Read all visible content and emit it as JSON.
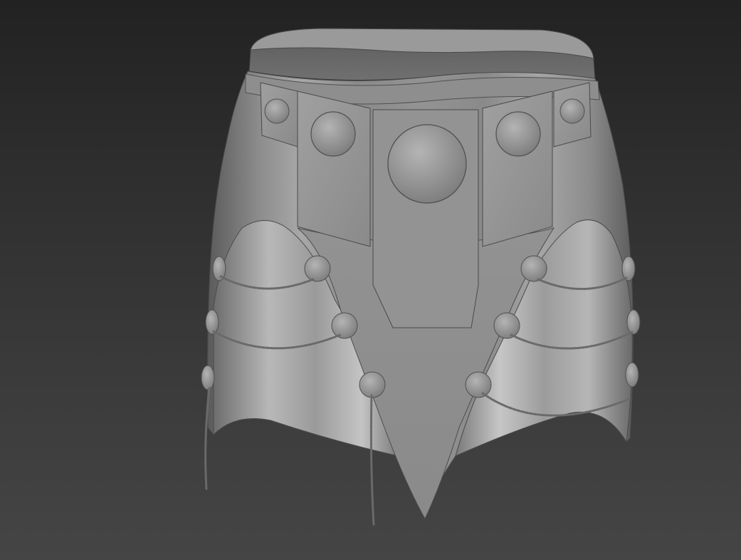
{
  "scene": {
    "subject": "skirt-armor-sculpt",
    "background_top": "#222222",
    "background_bottom": "#454545",
    "material_color": "#8f8f8f",
    "shadow_color": "#4a4a4a",
    "highlight_color": "#cfcfcf"
  }
}
